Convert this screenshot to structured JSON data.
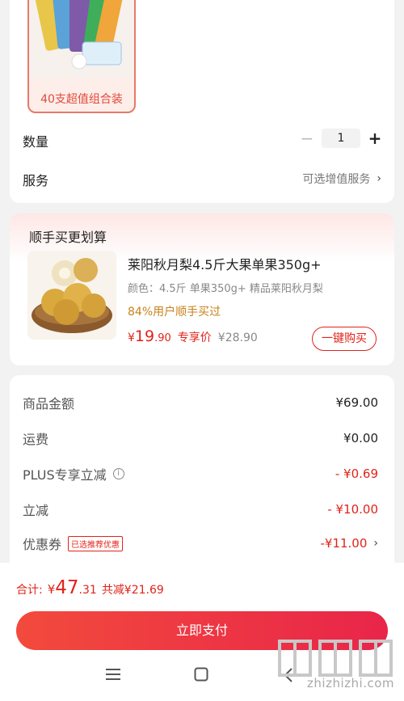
{
  "top_card": {
    "bundle_caption": "40支超值组合装",
    "quantity_label": "数量",
    "quantity_value": "1",
    "minus_glyph": "−",
    "plus_glyph": "+",
    "service_label": "服务",
    "service_value": "可选增值服务",
    "chevron": "›"
  },
  "addon": {
    "title": "顺手买更划算",
    "product_name": "莱阳秋月梨4.5斤大果单果350g+",
    "product_spec": "颜色：4.5斤 单果350g+ 精品莱阳秋月梨",
    "buy_hint": "84%用户顺手买过",
    "price_currency": "¥",
    "price_int": "19",
    "price_dec": ".90",
    "price_tag": "专享价",
    "price_orig": "¥28.90",
    "buy_button": "一键购买"
  },
  "summary": {
    "rows": [
      {
        "label": "商品金额",
        "value": "¥69.00"
      },
      {
        "label": "运费",
        "value": "¥0.00"
      },
      {
        "label": "PLUS专享立减",
        "value": "- ¥0.69"
      },
      {
        "label": "立减",
        "value": "- ¥10.00"
      },
      {
        "label": "优惠券",
        "value": "-¥11.00"
      }
    ],
    "info_glyph": "i",
    "coupon_badge": "已选推荐优惠",
    "chevron": "›"
  },
  "bottom": {
    "total_label": "合计:",
    "total_currency": "¥",
    "total_int": "47",
    "total_dec": ".31",
    "saved": "共减¥21.69",
    "pay_button": "立即支付",
    "watermark_text": "zhizhizhi.com"
  },
  "colors": {
    "accent": "#e2231a",
    "hint": "#c8821b"
  },
  "icons": [
    "menu-icon",
    "home-square-icon",
    "back-icon",
    "info-icon",
    "chevron-right-icon"
  ]
}
